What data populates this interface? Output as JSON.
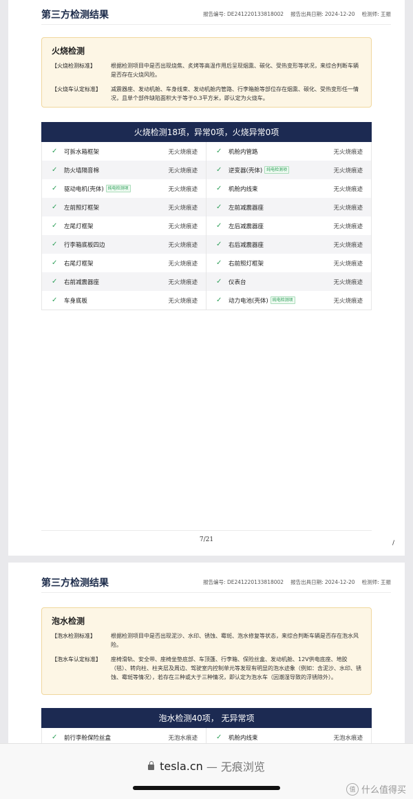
{
  "page1": {
    "header": {
      "title": "第三方检测结果",
      "report_no": "报告编号: DE241220133818002",
      "report_date": "报告出具日期: 2024-12-20",
      "inspector": "检测师: 王振"
    },
    "info": {
      "title": "火烧检测",
      "standards": [
        {
          "label": "【火烧检测标准】",
          "text": "根据检测项目中是否出现烧焦、炙烤等高温作用后呈现烟熏、碳化、受热变形等状况，来综合判断车辆是否存在火烧风险。"
        },
        {
          "label": "【火烧车认定标准】",
          "text": "减震器座、发动机舱、车身线束、发动机舱内管路、行李箱舱等部位存在烟熏、碳化、受热变形任一情况，且单个部件缺陷面积大于等于0.3平方米，即认定为火烧车。"
        }
      ]
    },
    "banner": "火烧检测18项，异常0项，火烧异常0项",
    "rows": [
      [
        {
          "name": "可拆水箱框架",
          "tag": "",
          "status": "无火烧痕迹"
        },
        {
          "name": "机舱内管路",
          "tag": "",
          "status": "无火烧痕迹"
        }
      ],
      [
        {
          "name": "防火墙隔音棉",
          "tag": "",
          "status": "无火烧痕迹"
        },
        {
          "name": "逆变器(壳体)",
          "tag": "纯电检测项",
          "status": "无火烧痕迹"
        }
      ],
      [
        {
          "name": "驱动电机(壳体)",
          "tag": "纯电检测项",
          "status": "无火烧痕迹"
        },
        {
          "name": "机舱内线束",
          "tag": "",
          "status": "无火烧痕迹"
        }
      ],
      [
        {
          "name": "左前照灯框架",
          "tag": "",
          "status": "无火烧痕迹"
        },
        {
          "name": "左前减震器座",
          "tag": "",
          "status": "无火烧痕迹"
        }
      ],
      [
        {
          "name": "左尾灯框架",
          "tag": "",
          "status": "无火烧痕迹"
        },
        {
          "name": "左后减震器座",
          "tag": "",
          "status": "无火烧痕迹"
        }
      ],
      [
        {
          "name": "行李箱底板四边",
          "tag": "",
          "status": "无火烧痕迹"
        },
        {
          "name": "右后减震器座",
          "tag": "",
          "status": "无火烧痕迹"
        }
      ],
      [
        {
          "name": "右尾灯框架",
          "tag": "",
          "status": "无火烧痕迹"
        },
        {
          "name": "右前照灯框架",
          "tag": "",
          "status": "无火烧痕迹"
        }
      ],
      [
        {
          "name": "右前减震器座",
          "tag": "",
          "status": "无火烧痕迹"
        },
        {
          "name": "仪表台",
          "tag": "",
          "status": "无火烧痕迹"
        }
      ],
      [
        {
          "name": "车身底板",
          "tag": "",
          "status": "无火烧痕迹"
        },
        {
          "name": "动力电池(壳体)",
          "tag": "纯电检测项",
          "status": "无火烧痕迹"
        }
      ]
    ],
    "page_number": "7/21",
    "corner_mark": "/"
  },
  "page2": {
    "header": {
      "title": "第三方检测结果",
      "report_no": "报告编号: DE241220133818002",
      "report_date": "报告出具日期: 2024-12-20",
      "inspector": "检测师: 王振"
    },
    "info": {
      "title": "泡水检测",
      "standards": [
        {
          "label": "【泡水检测标准】",
          "text": "根据检测项目中是否出现泥沙、水印、锈蚀、霉斑、泡水修复等状态，来综合判断车辆是否存在泡水风险。"
        },
        {
          "label": "【泡水车认定标准】",
          "text": "座椅滑轨、安全带、座椅坐垫底部、车顶篷、行李箱、保险丝盒、发动机舱、12V供电底座、地胶（毯）、转向柱、柱夹层及周边、驾驶室内控制单元等发现有明显的泡水迹象（例如：含泥沙、水印、锈蚀、霉斑等情况），若存在三种或大于三种情况，即认定为泡水车（因潮湿导致的浮锈除外）。"
        }
      ]
    },
    "banner": "泡水检测40项， 无异常项",
    "rows": [
      [
        {
          "name": "前行李舱保险丝盒",
          "tag": "",
          "status": "无泡水痕迹"
        },
        {
          "name": "机舱内线束",
          "tag": "",
          "status": "无泡水痕迹"
        }
      ]
    ]
  },
  "browser": {
    "url": "tesla.cn",
    "mode": "— 无痕浏览"
  },
  "watermark": {
    "logo": "值",
    "text": "什么值得买"
  },
  "colors": {
    "banner_bg": "#1c2a52",
    "check": "#2fa05a",
    "info_bg": "#fdf6e5",
    "info_border": "#f0d79d"
  }
}
